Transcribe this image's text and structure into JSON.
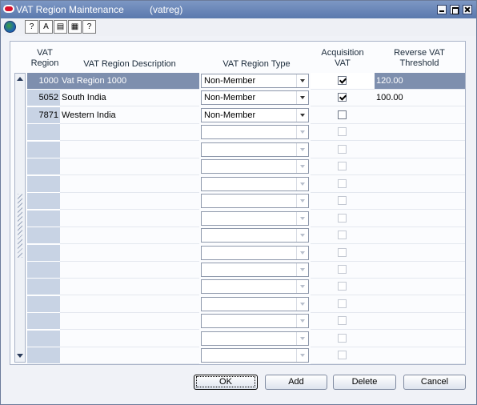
{
  "window": {
    "title": "VAT Region Maintenance",
    "code": "(vatreg)"
  },
  "toolbar": {
    "buttons": [
      "globe-icon",
      "help-icon",
      "spellcheck-icon",
      "notes-icon",
      "print-icon",
      "whatsthis-icon"
    ],
    "glyphs": [
      "",
      "?",
      "A",
      "▤",
      "▦",
      "?"
    ]
  },
  "table": {
    "headers": {
      "region": "VAT\nRegion",
      "description": "VAT Region Description",
      "type": "VAT Region Type",
      "acquisition": "Acquisition\nVAT",
      "threshold": "Reverse VAT\nThreshold"
    },
    "rows": [
      {
        "region": "1000",
        "description": "Vat Region 1000",
        "type": "Non-Member",
        "acquisition": true,
        "threshold": "120.00",
        "selected": true
      },
      {
        "region": "5052",
        "description": "South India",
        "type": "Non-Member",
        "acquisition": true,
        "threshold": "100.00",
        "selected": false
      },
      {
        "region": "7871",
        "description": "Western India",
        "type": "Non-Member",
        "acquisition": false,
        "threshold": "",
        "selected": false
      },
      {
        "region": "",
        "description": "",
        "type": "",
        "acquisition": false,
        "threshold": "",
        "selected": false,
        "empty": true
      },
      {
        "region": "",
        "description": "",
        "type": "",
        "acquisition": false,
        "threshold": "",
        "selected": false,
        "empty": true
      },
      {
        "region": "",
        "description": "",
        "type": "",
        "acquisition": false,
        "threshold": "",
        "selected": false,
        "empty": true
      },
      {
        "region": "",
        "description": "",
        "type": "",
        "acquisition": false,
        "threshold": "",
        "selected": false,
        "empty": true
      },
      {
        "region": "",
        "description": "",
        "type": "",
        "acquisition": false,
        "threshold": "",
        "selected": false,
        "empty": true
      },
      {
        "region": "",
        "description": "",
        "type": "",
        "acquisition": false,
        "threshold": "",
        "selected": false,
        "empty": true
      },
      {
        "region": "",
        "description": "",
        "type": "",
        "acquisition": false,
        "threshold": "",
        "selected": false,
        "empty": true
      },
      {
        "region": "",
        "description": "",
        "type": "",
        "acquisition": false,
        "threshold": "",
        "selected": false,
        "empty": true
      },
      {
        "region": "",
        "description": "",
        "type": "",
        "acquisition": false,
        "threshold": "",
        "selected": false,
        "empty": true
      },
      {
        "region": "",
        "description": "",
        "type": "",
        "acquisition": false,
        "threshold": "",
        "selected": false,
        "empty": true
      },
      {
        "region": "",
        "description": "",
        "type": "",
        "acquisition": false,
        "threshold": "",
        "selected": false,
        "empty": true
      },
      {
        "region": "",
        "description": "",
        "type": "",
        "acquisition": false,
        "threshold": "",
        "selected": false,
        "empty": true
      },
      {
        "region": "",
        "description": "",
        "type": "",
        "acquisition": false,
        "threshold": "",
        "selected": false,
        "empty": true
      },
      {
        "region": "",
        "description": "",
        "type": "",
        "acquisition": false,
        "threshold": "",
        "selected": false,
        "empty": true
      }
    ]
  },
  "buttons": {
    "ok": "OK",
    "add": "Add",
    "delete": "Delete",
    "cancel": "Cancel"
  },
  "colors": {
    "title_bar": "#5a79ad",
    "selected_row": "#7e8fae",
    "region_column": "#c8d3e4"
  }
}
